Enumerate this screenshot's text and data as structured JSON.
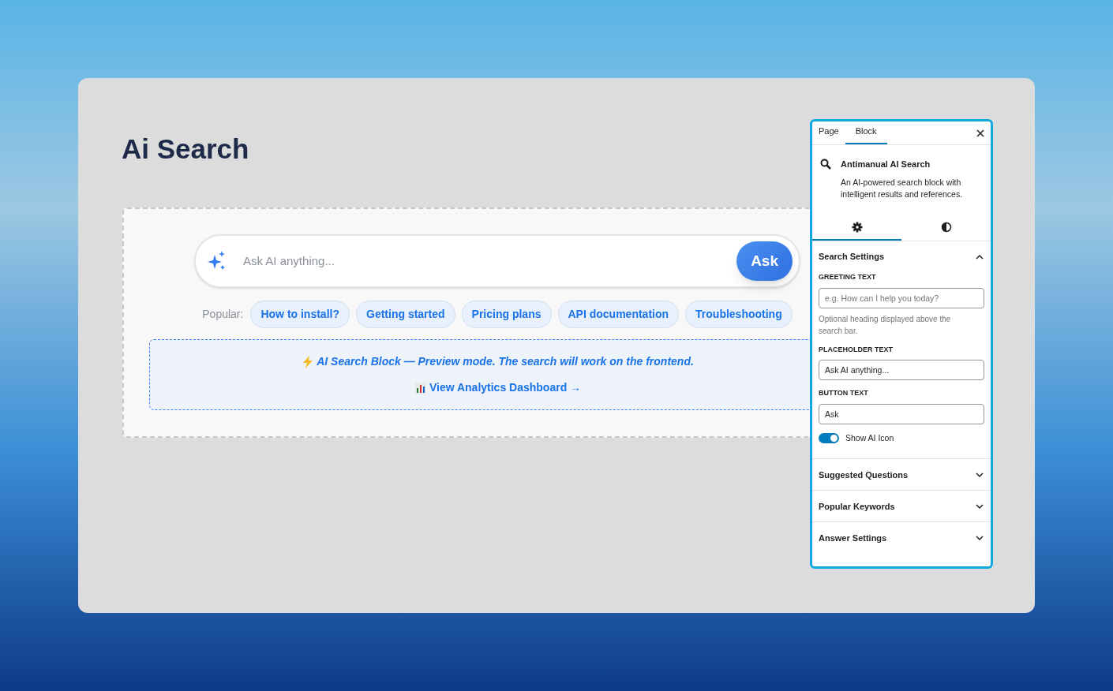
{
  "page": {
    "title": "Ai Search"
  },
  "search": {
    "placeholder": "Ask AI anything...",
    "button": "Ask",
    "show_icon": true
  },
  "popular": {
    "label": "Popular:",
    "keywords": [
      "How to install?",
      "Getting started",
      "Pricing plans",
      "API documentation",
      "Troubleshooting"
    ]
  },
  "notice": {
    "message": "AI Search Block — Preview mode. The search will work on the frontend.",
    "link": "View Analytics Dashboard →"
  },
  "panel": {
    "tabs": [
      {
        "label": "Page",
        "selected": false
      },
      {
        "label": "Block",
        "selected": true
      }
    ],
    "block": {
      "name": "Antimanual AI Search",
      "description": "An AI-powered search block with intelligent results and references."
    },
    "subtabs": [
      {
        "kind": "settings",
        "selected": true
      },
      {
        "kind": "styles",
        "selected": false
      }
    ],
    "sections": [
      {
        "title": "Search Settings",
        "expanded": true,
        "fields": [
          {
            "kind": "text",
            "label": "GREETING TEXT",
            "placeholder": "e.g. How can I help you today?",
            "help": "Optional heading displayed above the search bar."
          },
          {
            "kind": "text",
            "label": "PLACEHOLDER TEXT",
            "value": "Ask AI anything..."
          },
          {
            "kind": "text",
            "label": "BUTTON TEXT",
            "value": "Ask"
          },
          {
            "kind": "toggle",
            "label": "Show AI Icon",
            "on": true
          }
        ]
      },
      {
        "title": "Suggested Questions",
        "expanded": false
      },
      {
        "title": "Popular Keywords",
        "expanded": false
      },
      {
        "title": "Answer Settings",
        "expanded": false
      }
    ]
  }
}
